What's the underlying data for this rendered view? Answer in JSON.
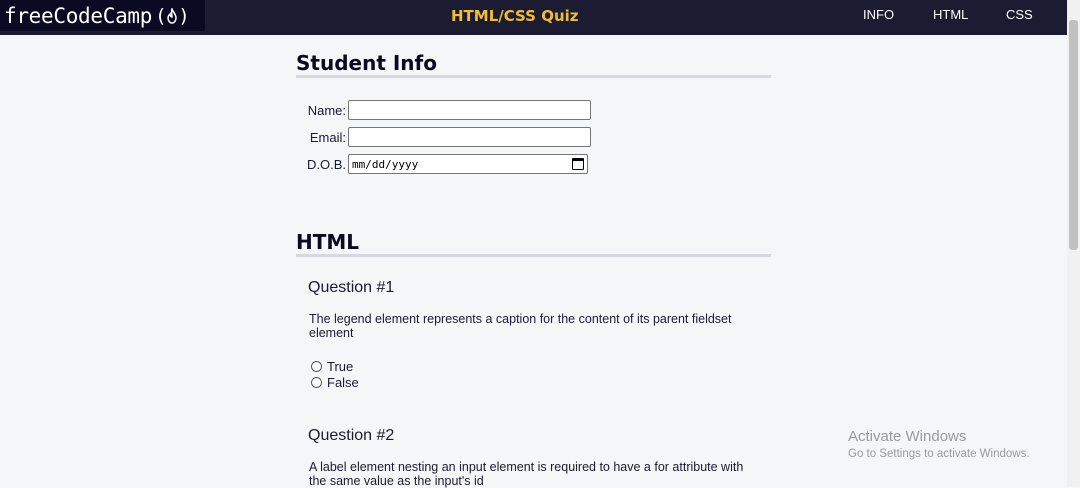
{
  "header": {
    "logo_text": "freeCodeCamp",
    "logo_icon": "(🔥)",
    "title": "HTML/CSS Quiz",
    "nav": [
      "INFO",
      "HTML",
      "CSS"
    ]
  },
  "student_info": {
    "heading": "Student Info",
    "name_label": "Name:",
    "name_value": "",
    "email_label": "Email:",
    "email_value": "",
    "dob_label": "D.O.B.",
    "dob_placeholder": "mm/dd/yyyy"
  },
  "html_section": {
    "heading": "HTML",
    "questions": [
      {
        "title": "Question #1",
        "text": "The legend element represents a caption for the content of its parent fieldset element",
        "options": [
          "True",
          "False"
        ]
      },
      {
        "title": "Question #2",
        "text": "A label element nesting an input element is required to have a for attribute with the same value as the input's id"
      }
    ]
  },
  "watermark": {
    "line1": "Activate Windows",
    "line2": "Go to Settings to activate Windows."
  },
  "colors": {
    "topbar": "#1b1b32",
    "logo_bg": "#0a0a23",
    "title_accent": "#f1be32",
    "page_bg": "#f5f6f7"
  }
}
